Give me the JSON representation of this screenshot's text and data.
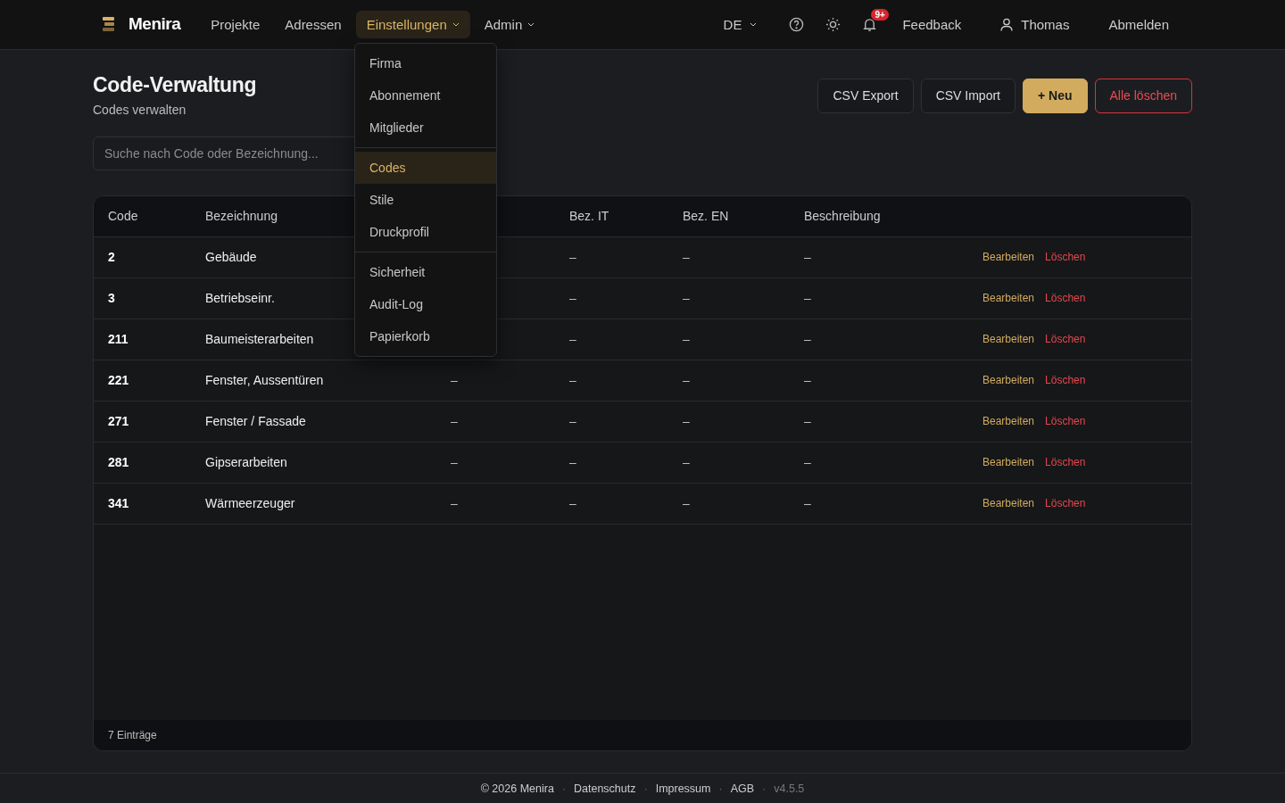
{
  "brand": "Menira",
  "nav": [
    {
      "label": "Projekte",
      "selected": false,
      "has_menu": false
    },
    {
      "label": "Adressen",
      "selected": false,
      "has_menu": false
    },
    {
      "label": "Einstellungen",
      "selected": true,
      "has_menu": true
    },
    {
      "label": "Admin",
      "selected": false,
      "has_menu": true
    }
  ],
  "language": "DE",
  "notifications_badge": "9+",
  "feedback": "Feedback",
  "user": "Thomas",
  "logout": "Abmelden",
  "dropdown": {
    "groups": [
      [
        {
          "label": "Firma",
          "selected": false
        },
        {
          "label": "Abonnement",
          "selected": false
        },
        {
          "label": "Mitglieder",
          "selected": false
        }
      ],
      [
        {
          "label": "Codes",
          "selected": true
        },
        {
          "label": "Stile",
          "selected": false
        },
        {
          "label": "Druckprofil",
          "selected": false
        }
      ],
      [
        {
          "label": "Sicherheit",
          "selected": false
        },
        {
          "label": "Audit-Log",
          "selected": false
        },
        {
          "label": "Papierkorb",
          "selected": false
        }
      ]
    ]
  },
  "header": {
    "title": "Code-Verwaltung",
    "subtitle": "Codes verwalten"
  },
  "actions": [
    {
      "label": "CSV Export",
      "kind": "default"
    },
    {
      "label": "CSV Import",
      "kind": "default"
    },
    {
      "label": "+ Neu",
      "kind": "primary"
    },
    {
      "label": "Alle löschen",
      "kind": "danger"
    }
  ],
  "search": {
    "placeholder": "Suche nach Code oder Bezeichnung..."
  },
  "table": {
    "columns": [
      {
        "kind": "code",
        "label": "Code"
      },
      {
        "kind": "name",
        "label": "Bezeichnung"
      },
      {
        "kind": "text"
      },
      {
        "kind": "text",
        "label": "Bez. IT"
      },
      {
        "kind": "text",
        "label": "Bez. EN"
      },
      {
        "kind": "text",
        "label": "Beschreibung"
      },
      {
        "kind": "actions"
      }
    ],
    "rows": [
      {
        "code": "2",
        "name": "Gebäude",
        "bez_it": "–",
        "bez_en": "–",
        "description": "–",
        "actions": [
          {
            "label": "Bearbeiten",
            "kind": "edit"
          },
          {
            "label": "Löschen",
            "kind": "delete"
          }
        ]
      },
      {
        "code": "3",
        "name": "Betriebseinr.",
        "bez_it": "–",
        "bez_en": "–",
        "description": "–",
        "actions": [
          {
            "label": "Bearbeiten",
            "kind": "edit"
          },
          {
            "label": "Löschen",
            "kind": "delete"
          }
        ]
      },
      {
        "code": "211",
        "name": "Baumeisterarbeiten",
        "bez_it": "–",
        "bez_en": "–",
        "description": "–",
        "actions": [
          {
            "label": "Bearbeiten",
            "kind": "edit"
          },
          {
            "label": "Löschen",
            "kind": "delete"
          }
        ]
      },
      {
        "code": "221",
        "name": "Fenster, Aussentüren",
        "column_3": "–",
        "bez_it": "–",
        "bez_en": "–",
        "description": "–",
        "actions": [
          {
            "label": "Bearbeiten",
            "kind": "edit"
          },
          {
            "label": "Löschen",
            "kind": "delete"
          }
        ]
      },
      {
        "code": "271",
        "name": "Fenster / Fassade",
        "column_3": "–",
        "bez_it": "–",
        "bez_en": "–",
        "description": "–",
        "actions": [
          {
            "label": "Bearbeiten",
            "kind": "edit"
          },
          {
            "label": "Löschen",
            "kind": "delete"
          }
        ]
      },
      {
        "code": "281",
        "name": "Gipserarbeiten",
        "column_3": "–",
        "bez_it": "–",
        "bez_en": "–",
        "description": "–",
        "actions": [
          {
            "label": "Bearbeiten",
            "kind": "edit"
          },
          {
            "label": "Löschen",
            "kind": "delete"
          }
        ]
      },
      {
        "code": "341",
        "name": "Wärmeerzeuger",
        "column_3": "–",
        "bez_it": "–",
        "bez_en": "–",
        "description": "–",
        "actions": [
          {
            "label": "Bearbeiten",
            "kind": "edit"
          },
          {
            "label": "Löschen",
            "kind": "delete"
          }
        ]
      }
    ],
    "footer": "7 Einträge"
  },
  "footer_separator": "·",
  "footer": [
    {
      "label": "© 2026 Menira",
      "kind": "text"
    },
    {
      "label": "Datenschutz",
      "kind": "link"
    },
    {
      "label": "Impressum",
      "kind": "link"
    },
    {
      "label": "AGB",
      "kind": "link"
    },
    {
      "label": "v4.5.5",
      "kind": "version"
    }
  ]
}
